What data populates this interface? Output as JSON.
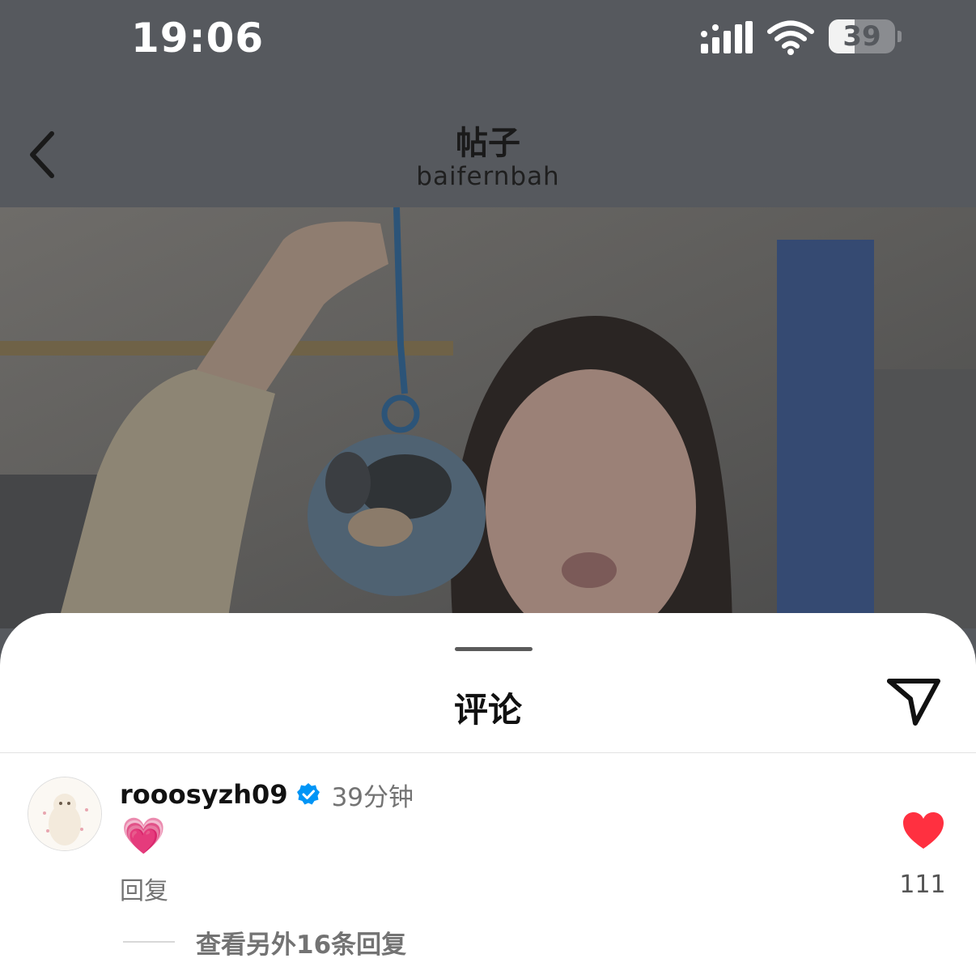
{
  "status_bar": {
    "time": "19:06",
    "battery_level": "39",
    "battery_fraction": 0.39,
    "signal_icon": "cellular-signal-icon",
    "wifi_icon": "wifi-icon"
  },
  "header": {
    "back_icon": "chevron-left-icon",
    "title": "帖子",
    "subtitle": "baifernbah"
  },
  "post": {
    "image_description": "photo-post",
    "overlay_color": "#000000"
  },
  "comments_sheet": {
    "title": "评论",
    "share_icon": "send-icon",
    "comments": [
      {
        "username": "rooosyzh09",
        "verified": true,
        "time": "39分钟",
        "text": "💗",
        "reply_label": "回复",
        "like_count": "111",
        "liked": true,
        "view_replies": "查看另外16条回复"
      }
    ]
  },
  "colors": {
    "like_red": "#ff3040",
    "verified_blue": "#0095f6",
    "dim_overlay": "#56595e"
  }
}
